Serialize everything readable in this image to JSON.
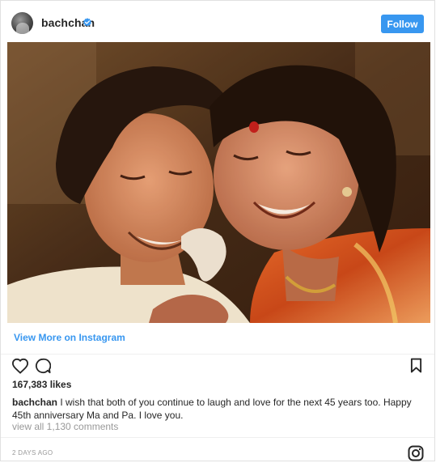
{
  "header": {
    "username": "bachchan",
    "follow_label": "Follow",
    "verified_color": "#3897f0"
  },
  "post": {
    "image_description": "",
    "view_more_label": "View More on Instagram",
    "likes": "167,383 likes",
    "caption_user": "bachchan",
    "caption_text": " I wish that both of you continue to laugh and love for the next 45 years too. Happy 45th anniversary Ma and Pa. I love you.",
    "comments_link": "view all 1,130 comments",
    "timestamp": "2 DAYS AGO"
  },
  "icons": {
    "avatar": "avatar",
    "verified": "verified-badge-icon",
    "like": "heart-icon",
    "comment": "comment-icon",
    "save": "bookmark-icon",
    "instagram": "instagram-logo-icon"
  },
  "colors": {
    "accent": "#3897f0",
    "text": "#262626",
    "muted": "#999999"
  }
}
